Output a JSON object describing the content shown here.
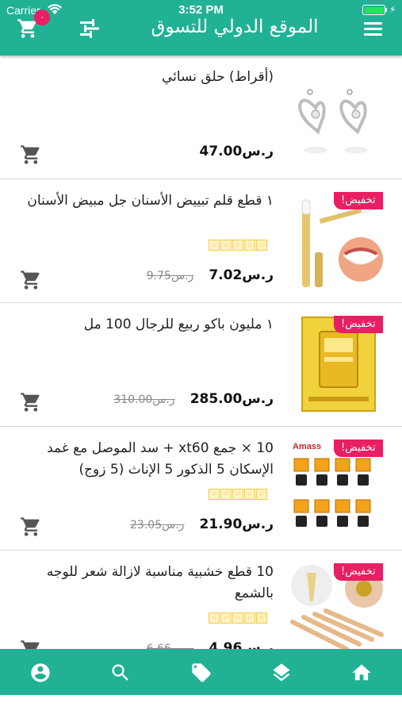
{
  "status_bar": {
    "carrier": "Carrier",
    "time": "3:52 PM"
  },
  "header": {
    "title": "الموقع الدولي للتسوق",
    "cart_count": "٠"
  },
  "currency": "ر.س",
  "sale_label": "تخفيض!",
  "products": [
    {
      "name": "(أقراط) حلق نسائي",
      "price": "47.00",
      "old_price": "",
      "on_sale": false,
      "rating_shown": false
    },
    {
      "name": "١ قطع قلم تبييض الأسنان جل مبيض الأسنان",
      "price": "7.02",
      "old_price": "9.75",
      "on_sale": true,
      "rating_shown": true
    },
    {
      "name": "١ مليون باكو ربيع للرجال 100 مل",
      "price": "285.00",
      "old_price": "310.00",
      "on_sale": true,
      "rating_shown": false
    },
    {
      "name": "10 × جمع xt60 + سد الموصل مع غمد الإسكان 5 الذكور 5 الإناث (5 زوج)",
      "price": "21.90",
      "old_price": "23.05",
      "on_sale": true,
      "rating_shown": true
    },
    {
      "name": "10 قطع خشبية مناسبة لازالة شعر للوجه بالشمع",
      "price": "4.96",
      "old_price": "6.66",
      "on_sale": true,
      "rating_shown": true
    }
  ],
  "tabbar": {
    "tabs": [
      {
        "name": "account",
        "icon": "account-circle-icon"
      },
      {
        "name": "search",
        "icon": "search-icon"
      },
      {
        "name": "offers",
        "icon": "tag-icon"
      },
      {
        "name": "categories",
        "icon": "layers-icon"
      },
      {
        "name": "home",
        "icon": "home-icon"
      }
    ]
  },
  "colors": {
    "primary": "#21b195",
    "sale": "#e91e63",
    "star": "#f2c94c"
  }
}
